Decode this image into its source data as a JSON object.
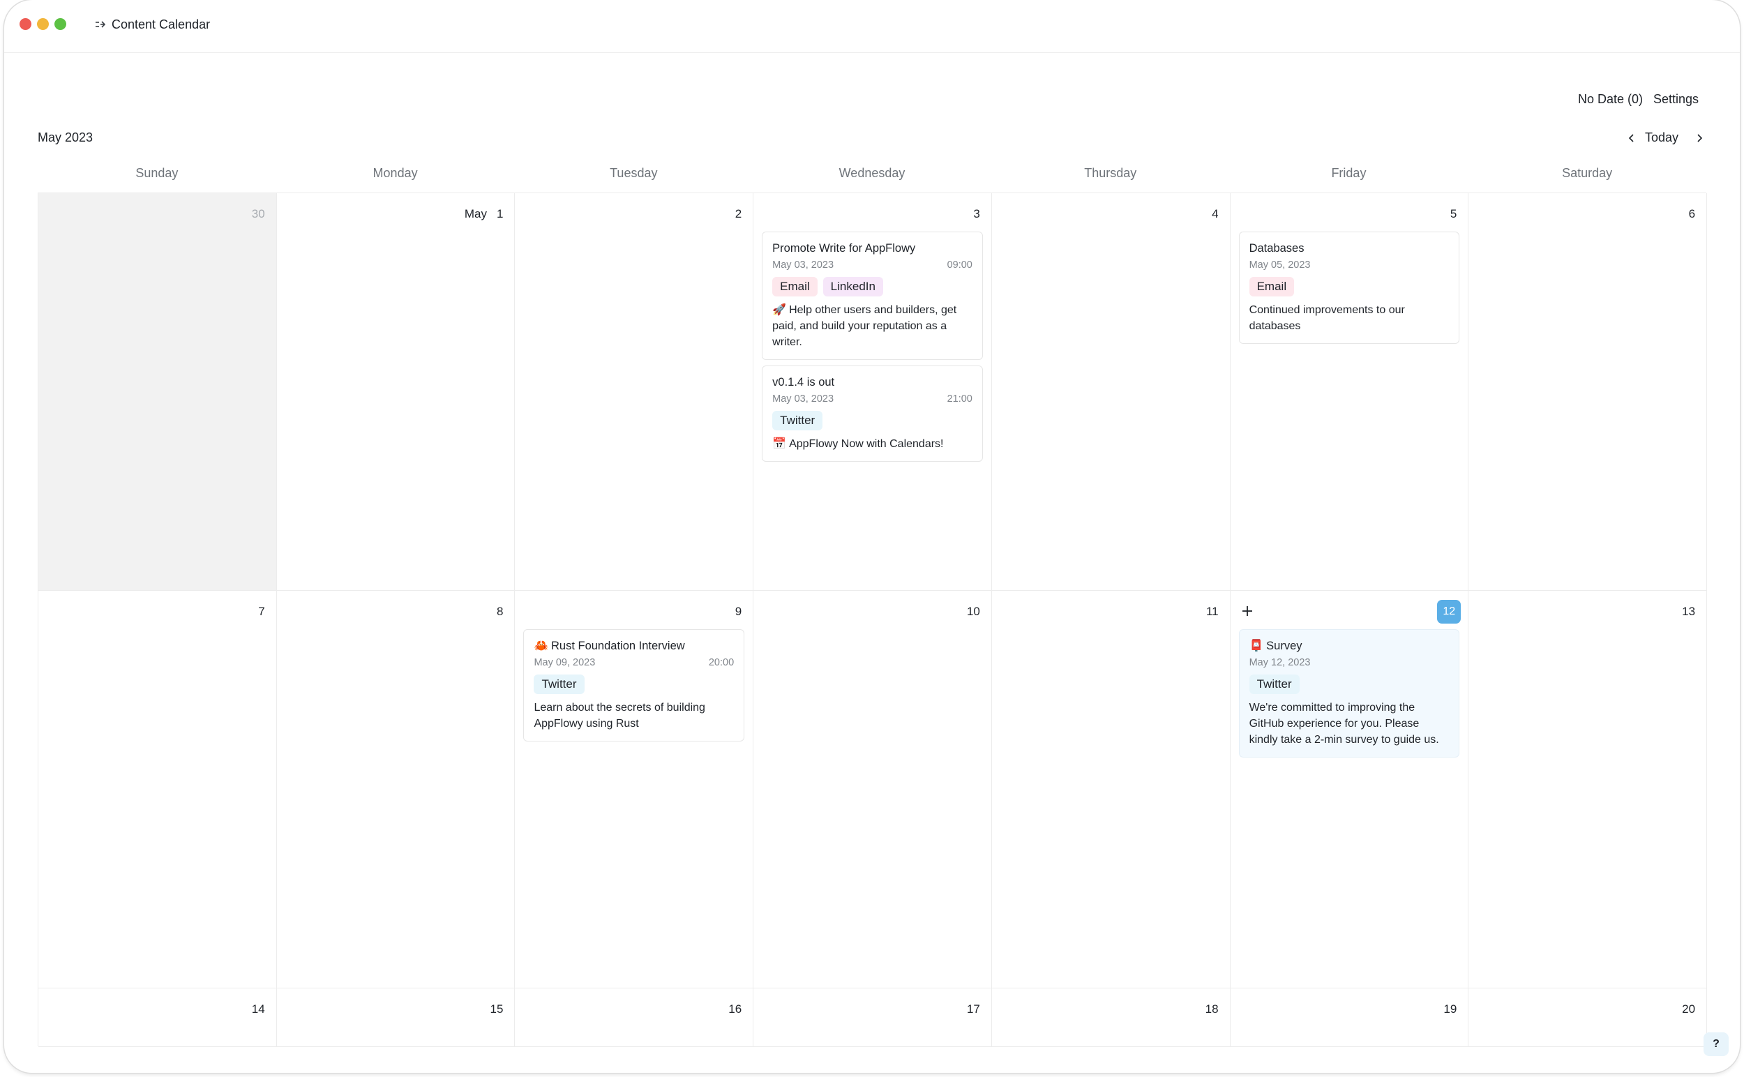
{
  "window": {
    "title": "Content Calendar"
  },
  "toolbar": {
    "no_date": "No Date (0)",
    "settings": "Settings"
  },
  "calendar": {
    "month_label": "May 2023",
    "today_label": "Today",
    "weekdays": [
      "Sunday",
      "Monday",
      "Tuesday",
      "Wednesday",
      "Thursday",
      "Friday",
      "Saturday"
    ],
    "days": {
      "apr30": "30",
      "may_month": "May",
      "may1": "1",
      "may2": "2",
      "may3": "3",
      "may4": "4",
      "may5": "5",
      "may6": "6",
      "may7": "7",
      "may8": "8",
      "may9": "9",
      "may10": "10",
      "may11": "11",
      "may12": "12",
      "may13": "13",
      "may14": "14",
      "may15": "15",
      "may16": "16",
      "may17": "17",
      "may18": "18",
      "may19": "19",
      "may20": "20"
    },
    "events": {
      "promote": {
        "title": "Promote Write for AppFlowy",
        "date": "May 03, 2023",
        "time": "09:00",
        "tags": [
          "Email",
          "LinkedIn"
        ],
        "emoji": "🚀",
        "description": "Help other users and builders, get paid, and build your reputation as a writer."
      },
      "release": {
        "title": "v0.1.4 is out",
        "date": "May 03, 2023",
        "time": "21:00",
        "tags": [
          "Twitter"
        ],
        "emoji": "📅",
        "description": "AppFlowy Now with Calendars!"
      },
      "databases": {
        "title": "Databases",
        "date": "May 05, 2023",
        "tags": [
          "Email"
        ],
        "description": "Continued improvements to our databases"
      },
      "rust": {
        "emoji": "🦀",
        "title": "Rust Foundation Interview",
        "date": "May 09, 2023",
        "time": "20:00",
        "tags": [
          "Twitter"
        ],
        "description": "Learn about the secrets of building AppFlowy using Rust"
      },
      "survey": {
        "emoji": "📮",
        "title": "Survey",
        "date": "May 12, 2023",
        "tags": [
          "Twitter"
        ],
        "description": "We're committed to improving the GitHub experience for you. Please kindly take a 2-min survey to guide us."
      }
    }
  },
  "help": {
    "label": "?"
  },
  "colors": {
    "accent_today": "#5aaee6",
    "tag_email": "#fde7ec",
    "tag_linkedin": "#f6e6f9",
    "tag_twitter": "#e6f5fb",
    "outside_month": "#f2f2f2"
  },
  "icons": [
    "sidebar-toggle-icon",
    "chevron-left-icon",
    "chevron-right-icon",
    "plus-icon"
  ]
}
